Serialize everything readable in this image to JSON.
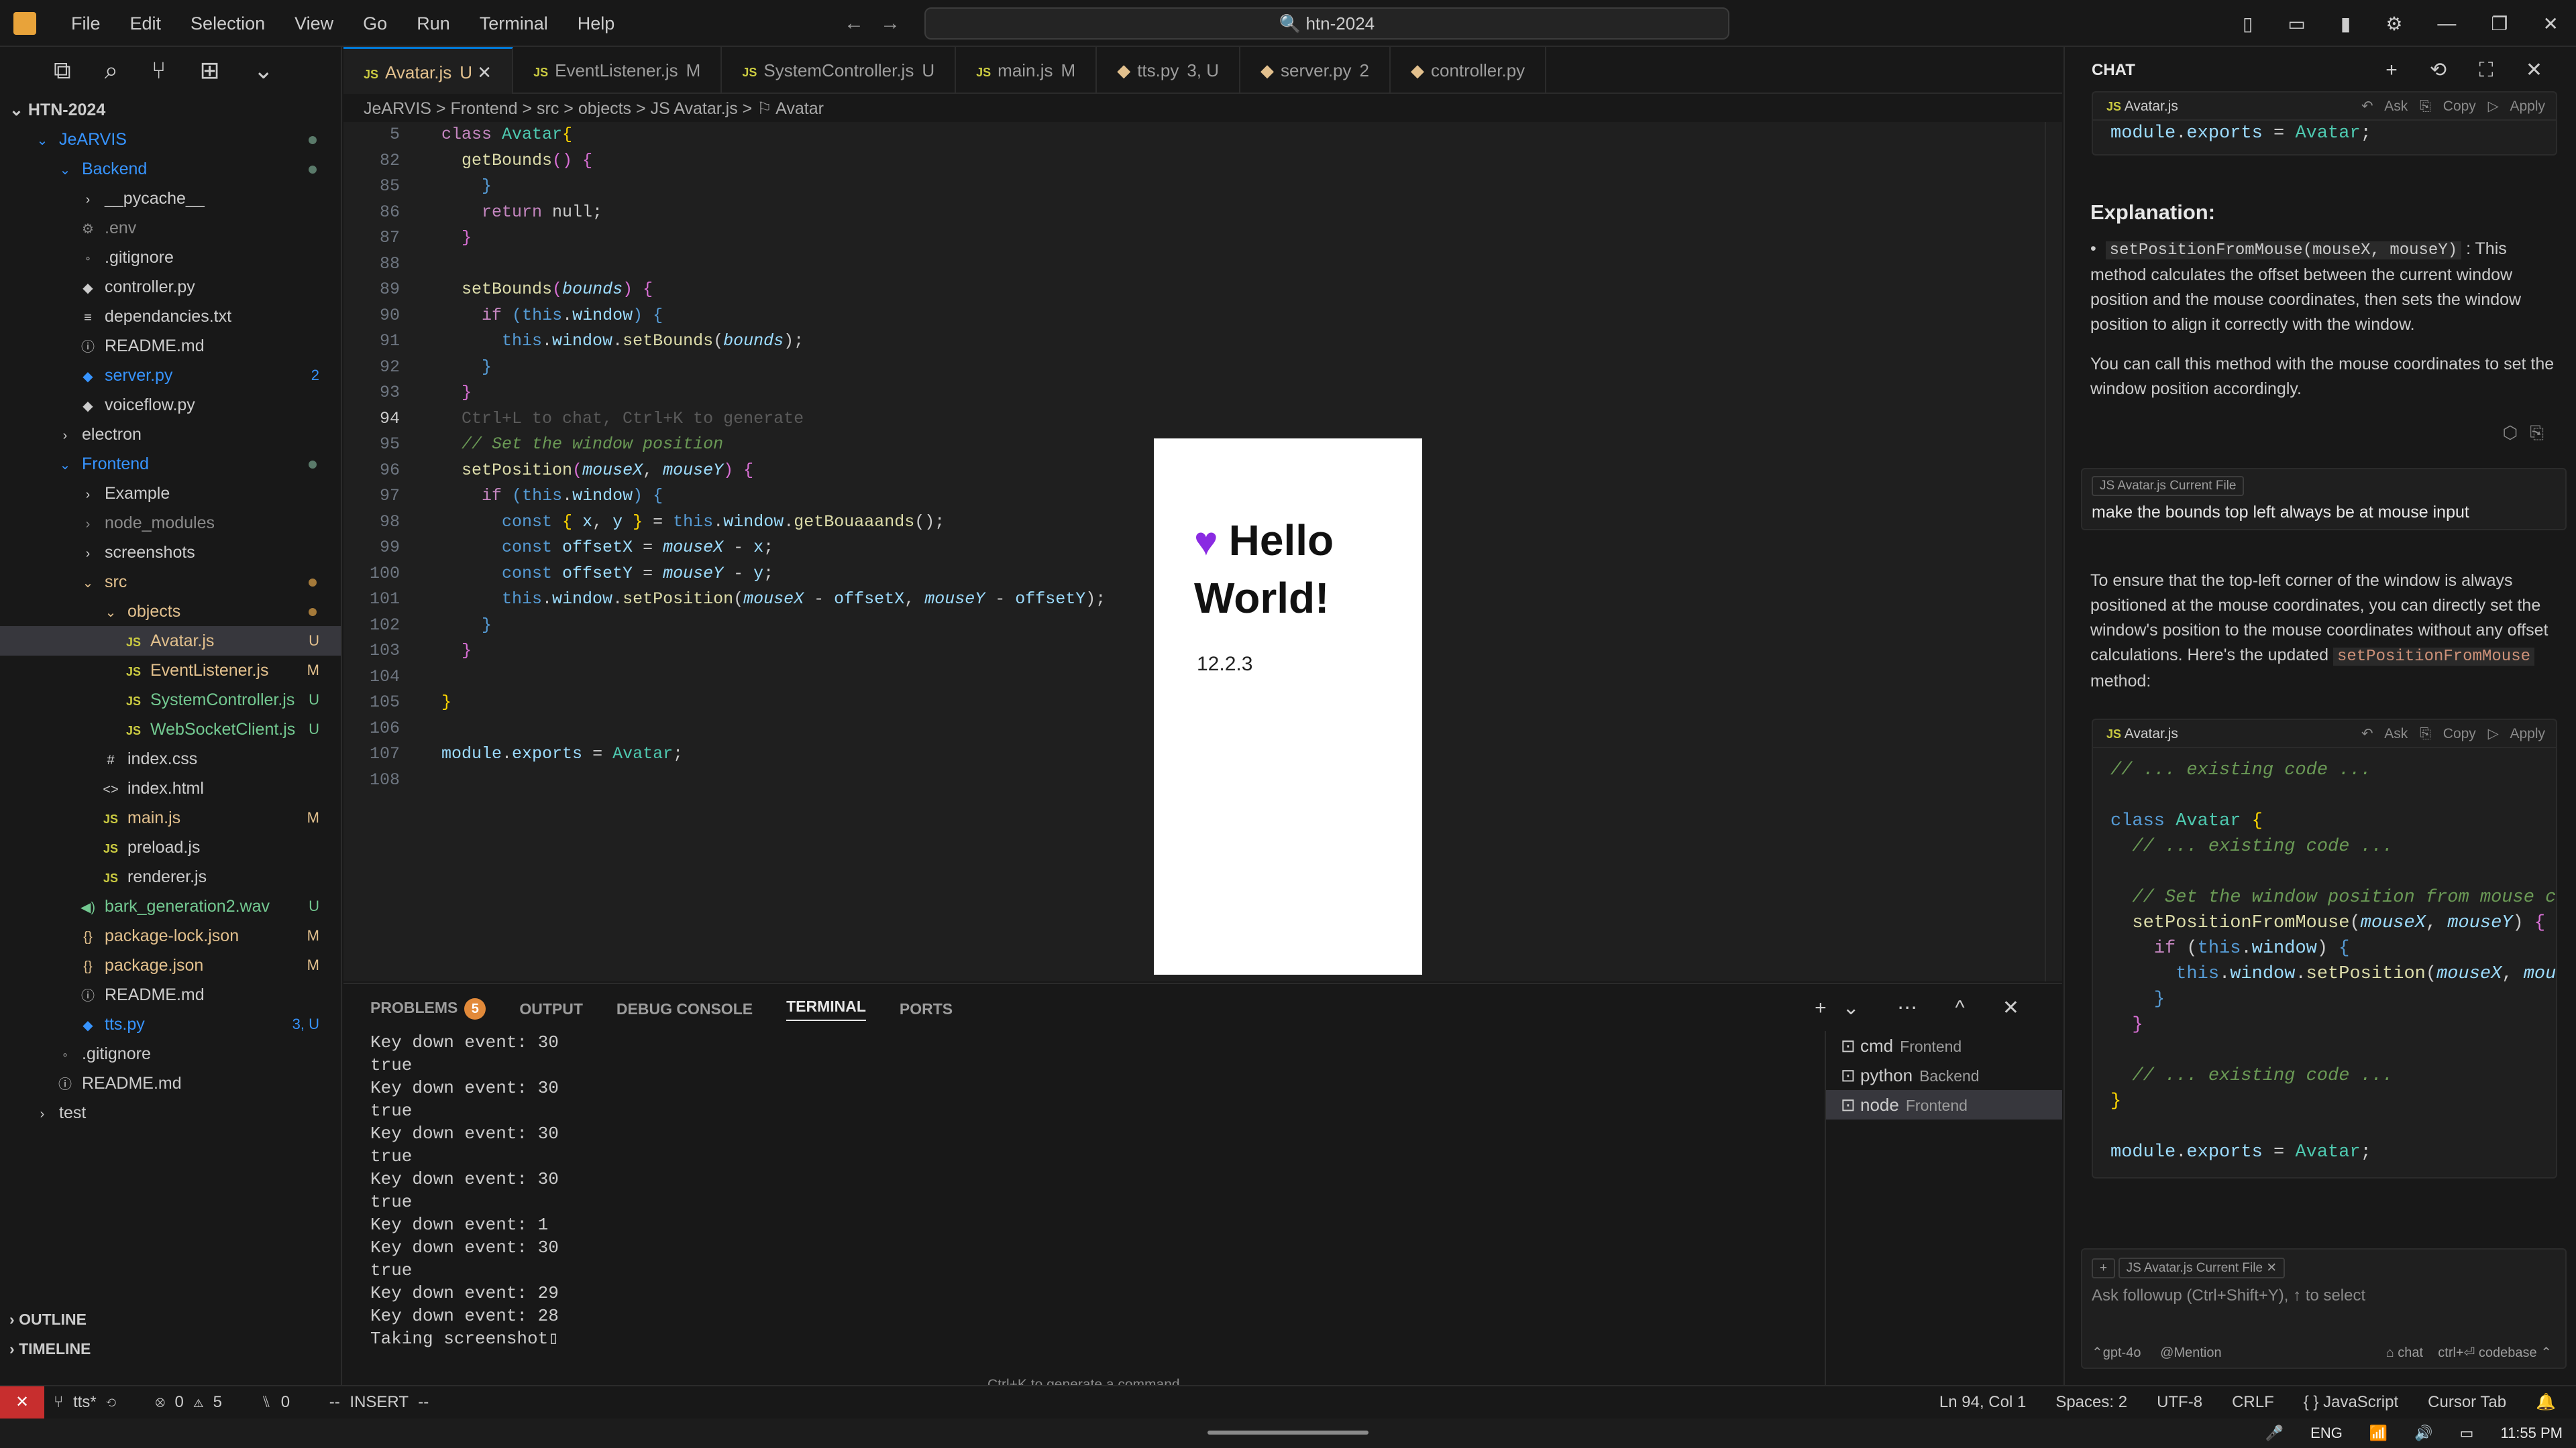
{
  "menu": [
    "File",
    "Edit",
    "Selection",
    "View",
    "Go",
    "Run",
    "Terminal",
    "Help"
  ],
  "search": "htn-2024",
  "explorer": {
    "root": "HTN-2024",
    "rows": [
      {
        "label": "JeARVIS",
        "indent": 1,
        "type": "folder",
        "color": "b",
        "dot": "g"
      },
      {
        "label": "Backend",
        "indent": 2,
        "type": "folder",
        "color": "b",
        "dot": "g"
      },
      {
        "label": "__pycache__",
        "indent": 3,
        "type": "folder-closed",
        "color": "w"
      },
      {
        "label": ".env",
        "indent": 3,
        "type": "gear",
        "color": "g"
      },
      {
        "label": ".gitignore",
        "indent": 3,
        "type": "dot",
        "color": "w"
      },
      {
        "label": "controller.py",
        "indent": 3,
        "type": "py",
        "color": "w"
      },
      {
        "label": "dependancies.txt",
        "indent": 3,
        "type": "txt",
        "color": "w"
      },
      {
        "label": "README.md",
        "indent": 3,
        "type": "info",
        "color": "w"
      },
      {
        "label": "server.py",
        "indent": 3,
        "type": "py",
        "color": "b",
        "tag": "2"
      },
      {
        "label": "voiceflow.py",
        "indent": 3,
        "type": "py",
        "color": "w"
      },
      {
        "label": "electron",
        "indent": 2,
        "type": "folder-closed",
        "color": "w"
      },
      {
        "label": "Frontend",
        "indent": 2,
        "type": "folder",
        "color": "b",
        "dot": "g"
      },
      {
        "label": "Example",
        "indent": 3,
        "type": "folder-closed",
        "color": "w"
      },
      {
        "label": "node_modules",
        "indent": 3,
        "type": "folder-closed",
        "color": "g"
      },
      {
        "label": "screenshots",
        "indent": 3,
        "type": "folder-closed",
        "color": "w"
      },
      {
        "label": "src",
        "indent": 3,
        "type": "folder",
        "color": "m",
        "dot": "o"
      },
      {
        "label": "objects",
        "indent": 4,
        "type": "folder",
        "color": "m",
        "dot": "o"
      },
      {
        "label": "Avatar.js",
        "indent": 5,
        "type": "js",
        "color": "m",
        "tag": "U",
        "sel": true
      },
      {
        "label": "EventListener.js",
        "indent": 5,
        "type": "js",
        "color": "m",
        "tag": "M"
      },
      {
        "label": "SystemController.js",
        "indent": 5,
        "type": "js",
        "color": "u",
        "tag": "U"
      },
      {
        "label": "WebSocketClient.js",
        "indent": 5,
        "type": "js",
        "color": "u",
        "tag": "U"
      },
      {
        "label": "index.css",
        "indent": 4,
        "type": "hash",
        "color": "w"
      },
      {
        "label": "index.html",
        "indent": 4,
        "type": "html",
        "color": "w"
      },
      {
        "label": "main.js",
        "indent": 4,
        "type": "js",
        "color": "m",
        "tag": "M"
      },
      {
        "label": "preload.js",
        "indent": 4,
        "type": "js",
        "color": "w"
      },
      {
        "label": "renderer.js",
        "indent": 4,
        "type": "js",
        "color": "w"
      },
      {
        "label": "bark_generation2.wav",
        "indent": 3,
        "type": "wav",
        "color": "u",
        "tag": "U"
      },
      {
        "label": "package-lock.json",
        "indent": 3,
        "type": "json",
        "color": "m",
        "tag": "M"
      },
      {
        "label": "package.json",
        "indent": 3,
        "type": "json",
        "color": "m",
        "tag": "M"
      },
      {
        "label": "README.md",
        "indent": 3,
        "type": "info",
        "color": "w"
      },
      {
        "label": "tts.py",
        "indent": 3,
        "type": "py",
        "color": "b",
        "tag": "3, U"
      },
      {
        "label": ".gitignore",
        "indent": 2,
        "type": "dot",
        "color": "w"
      },
      {
        "label": "README.md",
        "indent": 2,
        "type": "info",
        "color": "w"
      },
      {
        "label": "test",
        "indent": 1,
        "type": "folder-closed",
        "color": "w"
      }
    ],
    "outline": "OUTLINE",
    "timeline": "TIMELINE"
  },
  "tabs": [
    {
      "label": "Avatar.js",
      "status": "U",
      "icon": "JS",
      "active": true
    },
    {
      "label": "EventListener.js",
      "status": "M",
      "icon": "JS"
    },
    {
      "label": "SystemController.js",
      "status": "U",
      "icon": "JS"
    },
    {
      "label": "main.js",
      "status": "M",
      "icon": "JS"
    },
    {
      "label": "tts.py",
      "status": "3, U",
      "icon": "py"
    },
    {
      "label": "server.py",
      "status": "2",
      "icon": "py"
    },
    {
      "label": "controller.py",
      "status": "",
      "icon": "py"
    }
  ],
  "breadcrumb": "JeARVIS  >  Frontend  >  src  >  objects  >  JS Avatar.js  >  ⚐ Avatar",
  "code_lines": [
    {
      "n": "5",
      "html": "<span class='k'>class</span> <span class='t'>Avatar</span><span class='y'>{</span>"
    },
    {
      "n": "82",
      "html": "  <span class='f'>getBounds</span><span class='pk'>()</span> <span class='pk'>{</span>"
    },
    {
      "n": "85",
      "html": "    <span class='n'>}</span>"
    },
    {
      "n": "86",
      "html": "    <span class='k'>return</span> null;"
    },
    {
      "n": "87",
      "html": "  <span class='pk'>}</span>"
    },
    {
      "n": "88",
      "html": ""
    },
    {
      "n": "89",
      "html": "  <span class='f'>setBounds</span><span class='pk'>(</span><span class='i'>bounds</span><span class='pk'>)</span> <span class='pk'>{</span>"
    },
    {
      "n": "90",
      "html": "    <span class='k'>if</span> <span class='n'>(</span><span class='n'>this</span>.<span class='p'>window</span><span class='n'>)</span> <span class='n'>{</span>"
    },
    {
      "n": "91",
      "html": "      <span class='n'>this</span>.<span class='p'>window</span>.<span class='f'>setBounds</span>(<span class='i'>bounds</span>);"
    },
    {
      "n": "92",
      "html": "    <span class='n'>}</span>"
    },
    {
      "n": "93",
      "html": "  <span class='pk'>}</span>"
    },
    {
      "n": "94",
      "html": "  <span class='hint'>Ctrl+L to chat, Ctrl+K to generate</span>",
      "cur": true
    },
    {
      "n": "95",
      "html": "  <span class='c'>// Set the window position</span>"
    },
    {
      "n": "96",
      "html": "  <span class='f'>setPosition</span><span class='pk'>(</span><span class='i'>mouseX</span>, <span class='i'>mouseY</span><span class='pk'>)</span> <span class='pk'>{</span>"
    },
    {
      "n": "97",
      "html": "    <span class='k'>if</span> <span class='n'>(</span><span class='n'>this</span>.<span class='p'>window</span><span class='n'>)</span> <span class='n'>{</span>"
    },
    {
      "n": "98",
      "html": "      <span class='n'>const</span> <span class='y'>{</span> <span class='p'>x</span>, <span class='p'>y</span> <span class='y'>}</span> = <span class='n'>this</span>.<span class='p'>window</span>.<span class='f'>getBouaaands</span>();"
    },
    {
      "n": "99",
      "html": "      <span class='n'>const</span> <span class='p'>offsetX</span> = <span class='i'>mouseX</span> - <span class='p'>x</span>;"
    },
    {
      "n": "100",
      "html": "      <span class='n'>const</span> <span class='p'>offsetY</span> = <span class='i'>mouseY</span> - <span class='p'>y</span>;"
    },
    {
      "n": "101",
      "html": "      <span class='n'>this</span>.<span class='p'>window</span>.<span class='f'>setPosition</span>(<span class='i'>mouseX</span> - <span class='p'>offsetX</span>, <span class='i'>mouseY</span> - <span class='p'>offsetY</span>);"
    },
    {
      "n": "102",
      "html": "    <span class='n'>}</span>"
    },
    {
      "n": "103",
      "html": "  <span class='pk'>}</span>"
    },
    {
      "n": "104",
      "html": ""
    },
    {
      "n": "105",
      "html": "<span class='y'>}</span>"
    },
    {
      "n": "106",
      "html": ""
    },
    {
      "n": "107",
      "html": "<span class='p'>module</span>.<span class='p'>exports</span> = <span class='t'>Avatar</span>;"
    },
    {
      "n": "108",
      "html": ""
    }
  ],
  "popup": {
    "title": "Hello World!",
    "version": "12.2.3"
  },
  "panel": {
    "tabs": [
      "PROBLEMS",
      "OUTPUT",
      "DEBUG CONSOLE",
      "TERMINAL",
      "PORTS"
    ],
    "problems_count": "5",
    "terminal_lines": [
      "Key down event: 30",
      "true",
      "Key down event: 30",
      "true",
      "Key down event: 30",
      "true",
      "Key down event: 30",
      "true",
      "Key down event: 1",
      "Key down event: 30",
      "true",
      "Key down event: 29",
      "Key down event: 28",
      "Taking screenshot▯"
    ],
    "terminals": [
      {
        "name": "cmd",
        "sub": "Frontend"
      },
      {
        "name": "python",
        "sub": "Backend"
      },
      {
        "name": "node",
        "sub": "Frontend",
        "sel": true
      }
    ],
    "hint": "Ctrl+K to generate a command"
  },
  "chat": {
    "title": "CHAT",
    "block1_file": "Avatar.js",
    "block_actions": "↶ Ask   ⎘ Copy   ▷ Apply",
    "block1_line": "<span class='p'>module</span>.<span class='p'>exports</span> = <span class='t'>Avatar</span>;",
    "explanation_title": "Explanation:",
    "bullet_code": "setPositionFromMouse(mouseX, mouseY)",
    "bullet_text": ": This method calculates the offset between the current window position and the mouse coordinates, then sets the window position to align it correctly with the window.",
    "para1": "You can call this method with the mouse coordinates to set the window position accordingly.",
    "chip": "JS Avatar.js Current File",
    "user_msg": "make the bounds top left always be at mouse input",
    "answer": "To ensure that the top-left corner of the window is always positioned at the mouse coordinates, you can directly set the window's position to the mouse coordinates without any offset calculations. Here's the updated",
    "answer_code": "setPositionFromMouse",
    "answer_tail": "method:",
    "block2_lines": [
      "<span class='c'>// ... existing code ...</span>",
      "",
      "<span class='n'>class</span> <span class='t'>Avatar</span> <span class='y'>{</span>",
      "  <span class='c'>// ... existing code ...</span>",
      "",
      "  <span class='c'>// Set the window position from mouse co</span>",
      "  <span class='f'>setPositionFromMouse</span>(<span class='i'>mouseX</span>, <span class='i'>mouseY</span>) <span class='pk'>{</span>",
      "    <span class='k'>if</span> (<span class='n'>this</span>.<span class='p'>window</span>) <span class='n'>{</span>",
      "      <span class='n'>this</span>.<span class='p'>window</span>.<span class='f'>setPosition</span>(<span class='i'>mouseX</span>, <span class='i'>mous</span>",
      "    <span class='n'>}</span>",
      "  <span class='pk'>}</span>",
      "",
      "  <span class='c'>// ... existing code ...</span>",
      "<span class='y'>}</span>",
      "",
      "<span class='p'>module</span>.<span class='p'>exports</span> = <span class='t'>Avatar</span>;"
    ],
    "input_chip": "JS Avatar.js Current File ✕",
    "input_placeholder": "Ask followup (Ctrl+Shift+Y), ↑ to select",
    "model": "⌃gpt-4o",
    "mention": "@Mention",
    "chat_btn": "⌂ chat",
    "codebase_btn": "ctrl+⏎ codebase ⌃"
  },
  "status": {
    "branch": "⑂ tts*  ⟲",
    "errors": "⊗ 0  ⚠ 5",
    "ports": "⑊ 0",
    "mode": "-- INSERT --",
    "right": [
      "Ln 94, Col 1",
      "Spaces: 2",
      "UTF-8",
      "CRLF",
      "{ } JavaScript",
      "Cursor Tab",
      "🔔"
    ]
  },
  "taskbar": {
    "lang": "ENG",
    "time": "11:55 PM"
  }
}
